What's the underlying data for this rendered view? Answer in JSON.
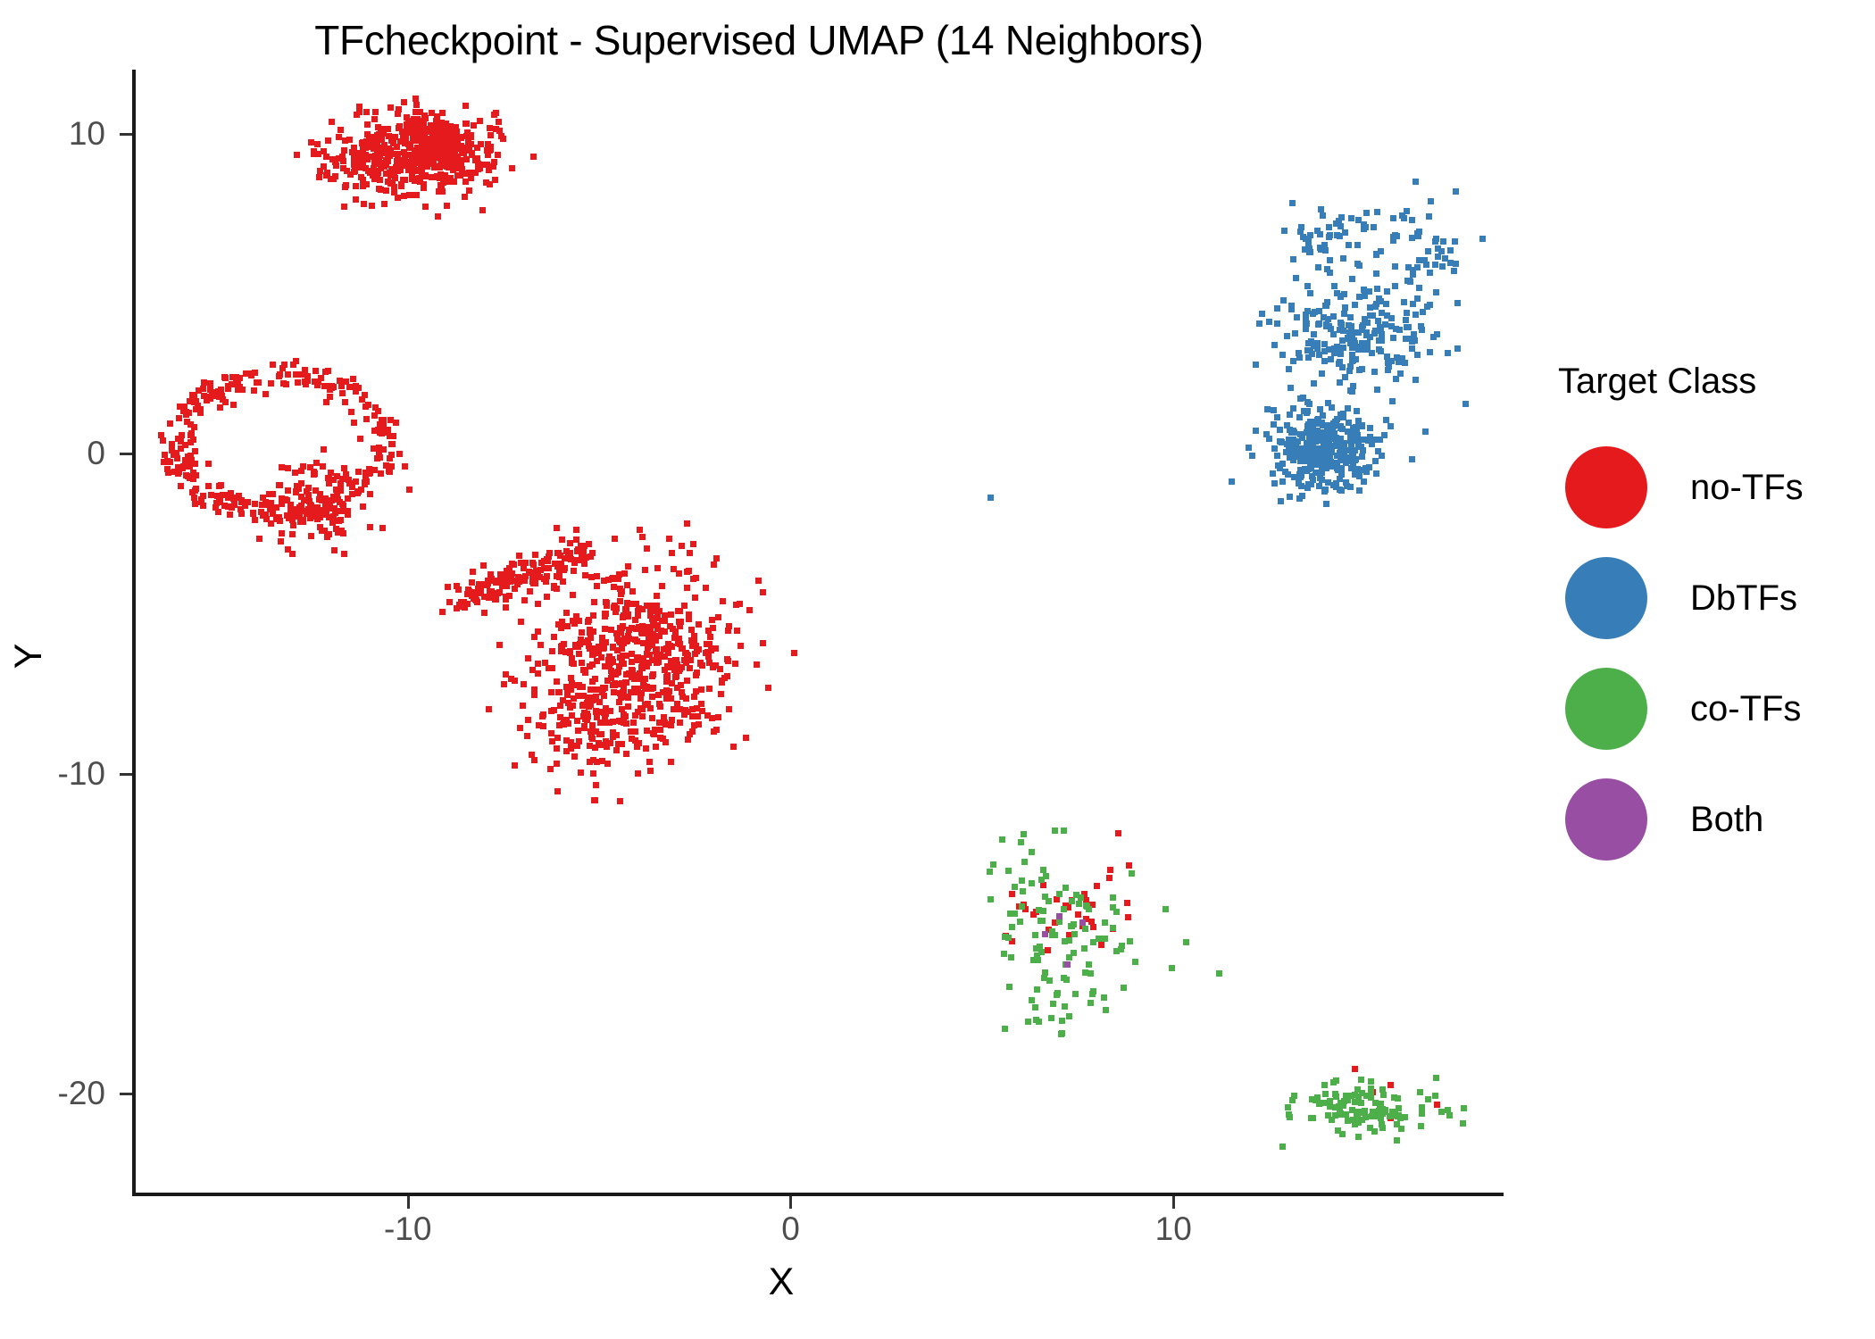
{
  "title": "TFcheckpoint - Supervised UMAP (14 Neighbors)",
  "axes": {
    "xlabel": "X",
    "ylabel": "Y"
  },
  "legend": {
    "title": "Target Class",
    "items": [
      {
        "label": "no-TFs",
        "color": "#e41a1c",
        "key_icon": "circle-swatch-icon"
      },
      {
        "label": "DbTFs",
        "color": "#377eb8",
        "key_icon": "circle-swatch-icon"
      },
      {
        "label": "co-TFs",
        "color": "#4daf4a",
        "key_icon": "circle-swatch-icon"
      },
      {
        "label": "Both",
        "color": "#984ea3",
        "key_icon": "circle-swatch-icon"
      }
    ]
  },
  "chart_data": {
    "type": "scatter",
    "title": "TFcheckpoint - Supervised UMAP (14 Neighbors)",
    "xlabel": "X",
    "ylabel": "Y",
    "grid": false,
    "legend_position": "right",
    "legend_title": "Target Class",
    "xlim": [
      -17.2,
      18.6
    ],
    "ylim": [
      -23.2,
      12.0
    ],
    "xticks": [
      -10,
      0,
      10
    ],
    "yticks": [
      10,
      0,
      -10,
      -20
    ],
    "xtick_labels": [
      "-10",
      "0",
      "10"
    ],
    "ytick_labels": [
      "10",
      "0",
      "-10",
      "-20"
    ],
    "series": [
      {
        "name": "no-TFs",
        "color": "#e41a1c",
        "n_points": 1870,
        "clusters": [
          {
            "cx": -10.0,
            "cy": 9.3,
            "sx": 1.05,
            "sy": 0.62,
            "n": 430,
            "shape": "blob"
          },
          {
            "cx": -9.2,
            "cy": 9.8,
            "sx": 0.55,
            "sy": 0.45,
            "n": 170,
            "shape": "blob"
          },
          {
            "cx": -13.3,
            "cy": 0.3,
            "sx": 2.0,
            "sy": 1.6,
            "n": 300,
            "shape": "ring"
          },
          {
            "cx": -12.4,
            "cy": -1.6,
            "sx": 0.75,
            "sy": 0.7,
            "n": 120,
            "shape": "blob"
          },
          {
            "cx": -7.0,
            "cy": -3.8,
            "sx": 1.7,
            "sy": 0.8,
            "n": 150,
            "shape": "streak"
          },
          {
            "cx": -4.0,
            "cy": -6.3,
            "sx": 1.3,
            "sy": 1.45,
            "n": 520,
            "shape": "blob"
          },
          {
            "cx": -5.0,
            "cy": -8.3,
            "sx": 1.3,
            "sy": 0.95,
            "n": 140,
            "shape": "blob"
          },
          {
            "cx": 7.3,
            "cy": -14.2,
            "sx": 0.8,
            "sy": 0.9,
            "n": 34,
            "shape": "sparse"
          },
          {
            "cx": 15.0,
            "cy": -20.3,
            "sx": 0.8,
            "sy": 0.45,
            "n": 6,
            "shape": "sparse"
          }
        ]
      },
      {
        "name": "DbTFs",
        "color": "#377eb8",
        "n_points": 720,
        "clusters": [
          {
            "cx": 13.9,
            "cy": 0.2,
            "sx": 0.7,
            "sy": 0.62,
            "n": 330,
            "shape": "blob"
          },
          {
            "cx": 14.6,
            "cy": 3.5,
            "sx": 0.95,
            "sy": 0.85,
            "n": 180,
            "shape": "blob"
          },
          {
            "cx": 14.0,
            "cy": 6.9,
            "sx": 0.55,
            "sy": 0.55,
            "n": 45,
            "shape": "sparse"
          },
          {
            "cx": 16.6,
            "cy": 6.6,
            "sx": 0.9,
            "sy": 0.8,
            "n": 40,
            "shape": "sparse"
          },
          {
            "cx": 16.2,
            "cy": 4.6,
            "sx": 0.8,
            "sy": 0.9,
            "n": 45,
            "shape": "sparse"
          },
          {
            "cx": 5.2,
            "cy": -1.3,
            "sx": 0.08,
            "sy": 0.06,
            "n": 1,
            "shape": "sparse"
          }
        ]
      },
      {
        "name": "co-TFs",
        "color": "#4daf4a",
        "n_points": 240,
        "clusters": [
          {
            "cx": 6.9,
            "cy": -15.3,
            "sx": 0.75,
            "sy": 1.55,
            "n": 95,
            "shape": "sparse"
          },
          {
            "cx": 15.0,
            "cy": -20.4,
            "sx": 0.95,
            "sy": 0.45,
            "n": 115,
            "shape": "blob"
          },
          {
            "cx": 8.6,
            "cy": -14.6,
            "sx": 0.9,
            "sy": 1.2,
            "n": 20,
            "shape": "sparse"
          }
        ]
      },
      {
        "name": "Both",
        "color": "#984ea3",
        "n_points": 4,
        "clusters": [
          {
            "cx": 7.2,
            "cy": -15.2,
            "sx": 0.55,
            "sy": 0.7,
            "n": 4,
            "shape": "sparse"
          }
        ]
      }
    ]
  }
}
